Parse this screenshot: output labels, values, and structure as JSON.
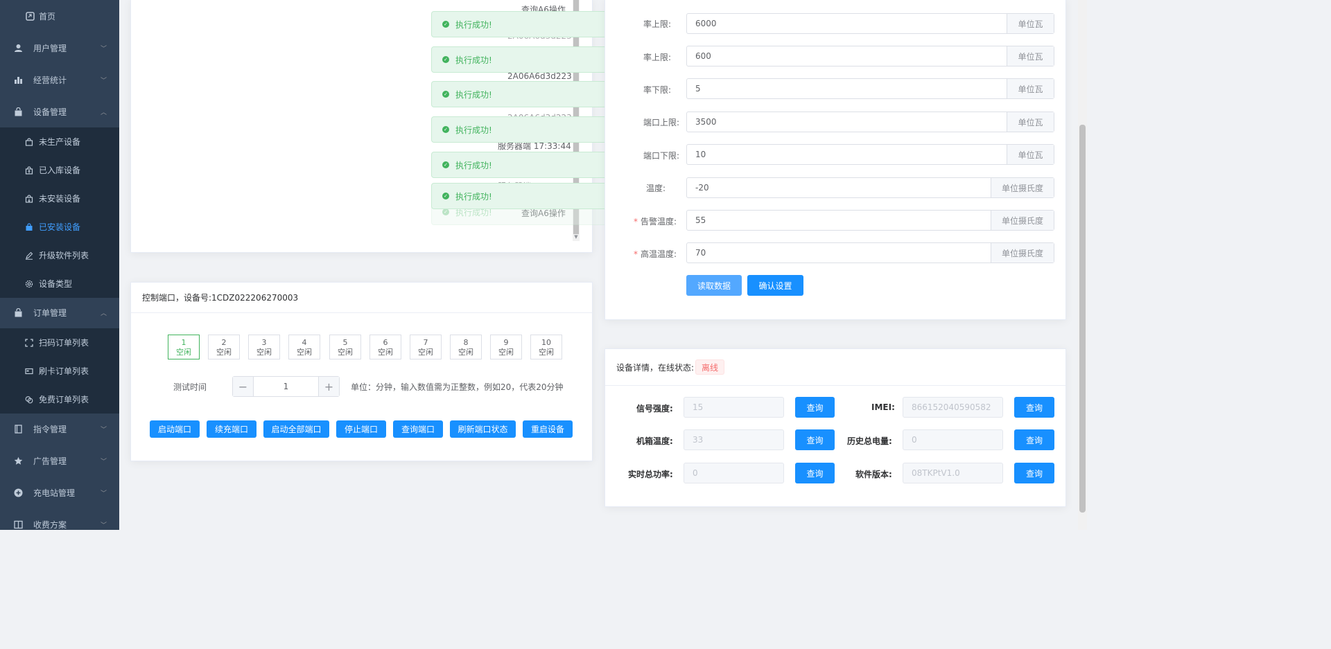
{
  "sidebar": {
    "home": {
      "label": "首页",
      "icon": "home-icon"
    },
    "groups": [
      {
        "label": "用户管理",
        "icon": "user-icon"
      },
      {
        "label": "经营统计",
        "icon": "bar-chart-icon"
      },
      {
        "label": "设备管理",
        "icon": "bag-icon"
      },
      {
        "label": "订单管理",
        "icon": "bag-icon"
      },
      {
        "label": "指令管理",
        "icon": "book-icon"
      },
      {
        "label": "广告管理",
        "icon": "star-icon"
      },
      {
        "label": "充电站管理",
        "icon": "plus-circle-icon"
      },
      {
        "label": "收费方案",
        "icon": "book-icon"
      }
    ],
    "device_sub": [
      {
        "label": "未生产设备",
        "icon": "bag-icon"
      },
      {
        "label": "已入库设备",
        "icon": "bag-in-icon"
      },
      {
        "label": "未安装设备",
        "icon": "bag-in-icon"
      },
      {
        "label": "已安装设备",
        "icon": "bag-filled-icon"
      },
      {
        "label": "升级软件列表",
        "icon": "edit-icon"
      },
      {
        "label": "设备类型",
        "icon": "gear-icon"
      }
    ],
    "order_sub": [
      {
        "label": "扫码订单列表",
        "icon": "scan-icon"
      },
      {
        "label": "刷卡订单列表",
        "icon": "card-icon"
      },
      {
        "label": "免费订单列表",
        "icon": "coins-icon"
      }
    ]
  },
  "log": {
    "lines": [
      "查询A6操作",
      "2A06A6d3d223",
      "2A06A6d3d223",
      "2A06A6d3d223",
      "服务器端 17:33:44",
      "服务器端 17:33:44",
      "查询A6操作"
    ]
  },
  "toasts": [
    "执行成功!",
    "执行成功!",
    "执行成功!",
    "执行成功!",
    "执行成功!",
    "执行成功!",
    "执行成功!"
  ],
  "control": {
    "title": "控制端口，设备号:1CDZ022206270003",
    "ports": [
      {
        "num": "1",
        "status": "空闲"
      },
      {
        "num": "2",
        "status": "空闲"
      },
      {
        "num": "3",
        "status": "空闲"
      },
      {
        "num": "4",
        "status": "空闲"
      },
      {
        "num": "5",
        "status": "空闲"
      },
      {
        "num": "6",
        "status": "空闲"
      },
      {
        "num": "7",
        "status": "空闲"
      },
      {
        "num": "8",
        "status": "空闲"
      },
      {
        "num": "9",
        "status": "空闲"
      },
      {
        "num": "10",
        "status": "空闲"
      }
    ],
    "test_time_label": "测试时间",
    "test_time_value": "1",
    "unit_hint": "单位：分钟，输入数值需为正整数，例如20，代表20分钟",
    "buttons": [
      "启动端口",
      "续充端口",
      "启动全部端口",
      "停止端口",
      "查询端口",
      "刷新端口状态",
      "重启设备"
    ]
  },
  "settings": {
    "rows": [
      {
        "label": "率上限:",
        "value": "6000",
        "unit": "单位瓦",
        "required": false
      },
      {
        "label": "率上限:",
        "value": "600",
        "unit": "单位瓦",
        "required": false
      },
      {
        "label": "率下限:",
        "value": "5",
        "unit": "单位瓦",
        "required": false
      },
      {
        "label": "端口上限:",
        "value": "3500",
        "unit": "单位瓦",
        "required": false
      },
      {
        "label": "端口下限:",
        "value": "10",
        "unit": "单位瓦",
        "required": false
      },
      {
        "label": "温度:",
        "value": "-20",
        "unit": "单位摄氏度",
        "required": false
      },
      {
        "label": "告警温度:",
        "value": "55",
        "unit": "单位摄氏度",
        "required": true
      },
      {
        "label": "高温温度:",
        "value": "70",
        "unit": "单位摄氏度",
        "required": true
      }
    ],
    "read_button": "读取数据",
    "confirm_button": "确认设置"
  },
  "details": {
    "title": "设备详情，在线状态:",
    "status": "离线",
    "query_label": "查询",
    "left": [
      {
        "label": "信号强度:",
        "value": "15"
      },
      {
        "label": "机箱温度:",
        "value": "33"
      },
      {
        "label": "实时总功率:",
        "value": "0"
      }
    ],
    "right": [
      {
        "label": "IMEI:",
        "value": "866152040590582"
      },
      {
        "label": "历史总电量:",
        "value": "0"
      },
      {
        "label": "软件版本:",
        "value": "08TKPtV1.0"
      }
    ]
  },
  "colors": {
    "sidebar_bg": "#304156",
    "submenu_bg": "#1f2d3d",
    "primary": "#1890ff",
    "success": "#41b35d",
    "danger": "#f56c6c"
  }
}
